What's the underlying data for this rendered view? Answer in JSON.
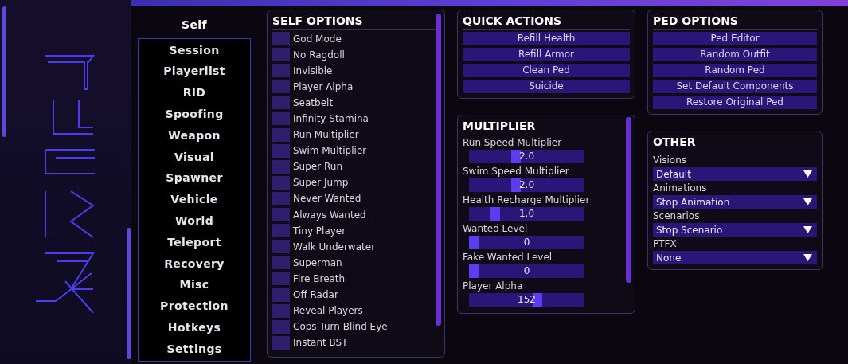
{
  "nav": [
    {
      "label": "Self",
      "selected": true
    },
    {
      "label": "Session",
      "selected": false
    },
    {
      "label": "Playerlist",
      "selected": false
    },
    {
      "label": "RID",
      "selected": false
    },
    {
      "label": "Spoofing",
      "selected": false
    },
    {
      "label": "Weapon",
      "selected": false
    },
    {
      "label": "Visual",
      "selected": false
    },
    {
      "label": "Spawner",
      "selected": false
    },
    {
      "label": "Vehicle",
      "selected": false
    },
    {
      "label": "World",
      "selected": false
    },
    {
      "label": "Teleport",
      "selected": false
    },
    {
      "label": "Recovery",
      "selected": false
    },
    {
      "label": "Misc",
      "selected": false
    },
    {
      "label": "Protection",
      "selected": false
    },
    {
      "label": "Hotkeys",
      "selected": false
    },
    {
      "label": "Settings",
      "selected": false
    }
  ],
  "self_options": {
    "title": "SELF OPTIONS",
    "items": [
      {
        "label": "God Mode",
        "checked": false
      },
      {
        "label": "No Ragdoll",
        "checked": false
      },
      {
        "label": "Invisible",
        "checked": false
      },
      {
        "label": "Player Alpha",
        "checked": false
      },
      {
        "label": "Seatbelt",
        "checked": false
      },
      {
        "label": "Infinity Stamina",
        "checked": false
      },
      {
        "label": "Run Multiplier",
        "checked": false
      },
      {
        "label": "Swim Multiplier",
        "checked": false
      },
      {
        "label": "Super Run",
        "checked": false
      },
      {
        "label": "Super Jump",
        "checked": false
      },
      {
        "label": "Never Wanted",
        "checked": false
      },
      {
        "label": "Always Wanted",
        "checked": false
      },
      {
        "label": "Tiny Player",
        "checked": false
      },
      {
        "label": "Walk Underwater",
        "checked": false
      },
      {
        "label": "Superman",
        "checked": false
      },
      {
        "label": "Fire Breath",
        "checked": false
      },
      {
        "label": "Off Radar",
        "checked": false
      },
      {
        "label": "Reveal Players",
        "checked": false
      },
      {
        "label": "Cops Turn Blind Eye",
        "checked": false
      },
      {
        "label": "Instant BST",
        "checked": false
      }
    ]
  },
  "quick_actions": {
    "title": "QUICK ACTIONS",
    "buttons": [
      "Refill Health",
      "Refill Armor",
      "Clean Ped",
      "Suicide"
    ]
  },
  "ped_options": {
    "title": "PED OPTIONS",
    "buttons": [
      "Ped Editor",
      "Random Outfit",
      "Random Ped",
      "Set Default Components",
      "Restore Original Ped"
    ]
  },
  "multiplier": {
    "title": "MULTIPLIER",
    "sliders": [
      {
        "label": "Run Speed Multiplier",
        "value": "2.0",
        "level": 0.4
      },
      {
        "label": "Swim Speed Multiplier",
        "value": "2.0",
        "level": 0.4
      },
      {
        "label": "Health Recharge Multiplier",
        "value": "1.0",
        "level": 0.2
      },
      {
        "label": "Wanted Level",
        "value": "0",
        "level": 0
      },
      {
        "label": "Fake Wanted Level",
        "value": "0",
        "level": 0
      },
      {
        "label": "Player Alpha",
        "value": "152",
        "level": 0.6
      }
    ]
  },
  "other": {
    "title": "OTHER",
    "dropdowns": [
      {
        "label": "Visions",
        "value": "Default"
      },
      {
        "label": "Animations",
        "value": "Stop Animation"
      },
      {
        "label": "Scenarios",
        "value": "Stop Scenario"
      },
      {
        "label": "PTFX",
        "value": "None"
      }
    ]
  }
}
